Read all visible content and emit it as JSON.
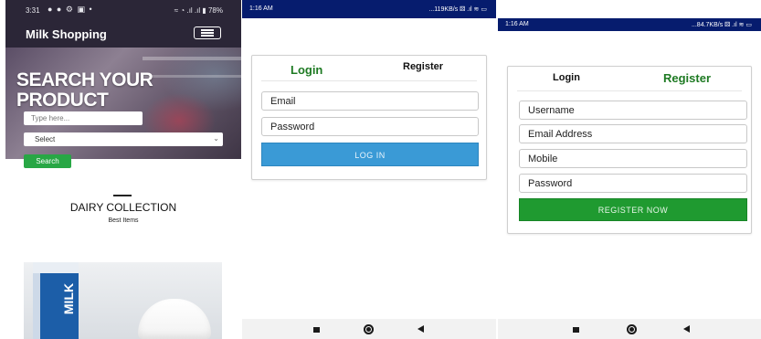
{
  "home": {
    "status": {
      "time": "3:31",
      "icons": "● ● ⚙ ▣ •",
      "right": "≈ ◔ .ıl .ıl ▮ 78%"
    },
    "brand": "Milk Shopping",
    "hero_title": "SEARCH YOUR PRODUCT",
    "search_placeholder": "Type here...",
    "select_value": "Select",
    "search_button": "Search",
    "section_title": "DAIRY COLLECTION",
    "section_subtitle": "Best Items",
    "product_label": "MILK"
  },
  "login": {
    "status": {
      "time": "1:16 AM",
      "right": "...119KB/s ⚄ .ıl ≋ ▭"
    },
    "tab_login": "Login",
    "tab_register": "Register",
    "email_placeholder": "Email",
    "password_placeholder": "Password",
    "login_button": "LOG IN"
  },
  "register": {
    "status": {
      "time": "1:16 AM",
      "right": "...84.7KB/s ⚄ .ıl ≋ ▭"
    },
    "tab_login": "Login",
    "tab_register": "Register",
    "username_placeholder": "Username",
    "email_placeholder": "Email Address",
    "mobile_placeholder": "Mobile",
    "password_placeholder": "Password",
    "register_button": "REGISTER NOW"
  },
  "colors": {
    "accent_green": "#1e7a23",
    "login_blue": "#3a9ad6",
    "header_dark": "#2b2637",
    "status_blue": "#061c6e"
  }
}
